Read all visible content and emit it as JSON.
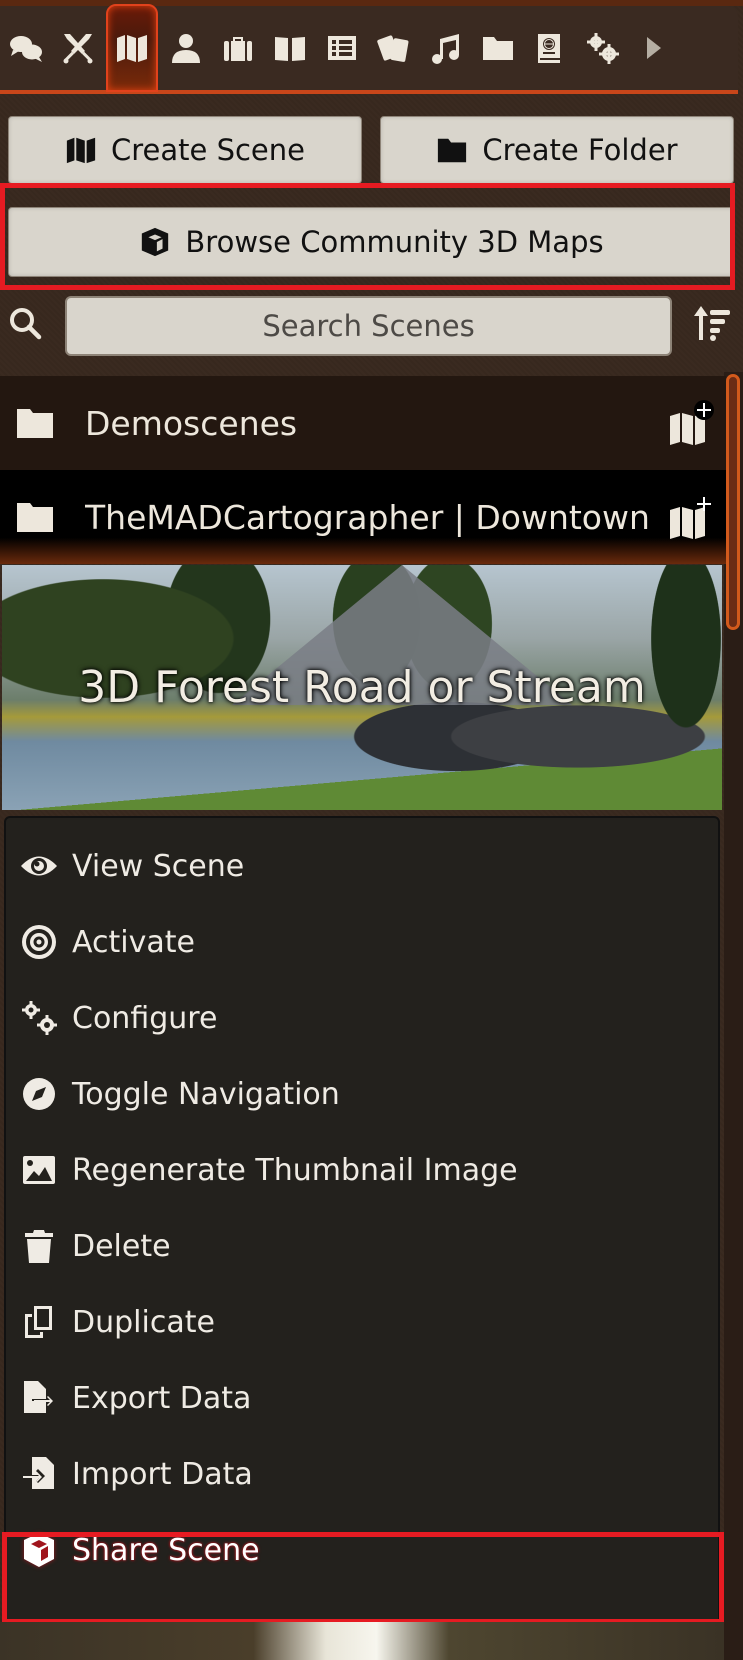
{
  "tabs": [
    {
      "name": "chat",
      "icon": "comments-icon",
      "active": false
    },
    {
      "name": "combat",
      "icon": "crossed-swords-icon",
      "active": false
    },
    {
      "name": "scenes",
      "icon": "map-icon",
      "active": true
    },
    {
      "name": "actors",
      "icon": "user-icon",
      "active": false
    },
    {
      "name": "items",
      "icon": "suitcase-icon",
      "active": false
    },
    {
      "name": "journal",
      "icon": "book-open-icon",
      "active": false
    },
    {
      "name": "tables",
      "icon": "table-list-icon",
      "active": false
    },
    {
      "name": "cards",
      "icon": "playing-cards-icon",
      "active": false
    },
    {
      "name": "playlists",
      "icon": "music-icon",
      "active": false
    },
    {
      "name": "compendium",
      "icon": "folder-icon",
      "active": false
    },
    {
      "name": "wiki",
      "icon": "atlas-icon",
      "active": false
    },
    {
      "name": "settings",
      "icon": "gears-icon",
      "active": false
    },
    {
      "name": "more",
      "icon": "caret-right-icon",
      "active": false
    }
  ],
  "actions": {
    "create_scene": "Create Scene",
    "create_folder": "Create Folder",
    "browse_3d": "Browse Community 3D Maps"
  },
  "search": {
    "placeholder": "Search Scenes",
    "value": ""
  },
  "folders": [
    {
      "name": "Demoscenes"
    },
    {
      "name": "TheMADCartographer | Downtown"
    }
  ],
  "scene": {
    "title": "3D Forest Road or Stream"
  },
  "context_menu": {
    "items": [
      {
        "label": "View Scene",
        "icon": "eye-icon"
      },
      {
        "label": "Activate",
        "icon": "bullseye-icon"
      },
      {
        "label": "Configure",
        "icon": "gears-icon"
      },
      {
        "label": "Toggle Navigation",
        "icon": "compass-icon"
      },
      {
        "label": "Regenerate Thumbnail Image",
        "icon": "image-icon"
      },
      {
        "label": "Delete",
        "icon": "trash-icon"
      },
      {
        "label": "Duplicate",
        "icon": "copy-icon"
      },
      {
        "label": "Export Data",
        "icon": "file-export-icon"
      },
      {
        "label": "Import Data",
        "icon": "file-import-icon"
      },
      {
        "label": "Share Scene",
        "icon": "cube-icon"
      }
    ]
  },
  "colors": {
    "accent": "#e1421c",
    "highlight": "#e61b22",
    "menu_bg": "#23211d",
    "button_bg": "#d9d5cc"
  }
}
